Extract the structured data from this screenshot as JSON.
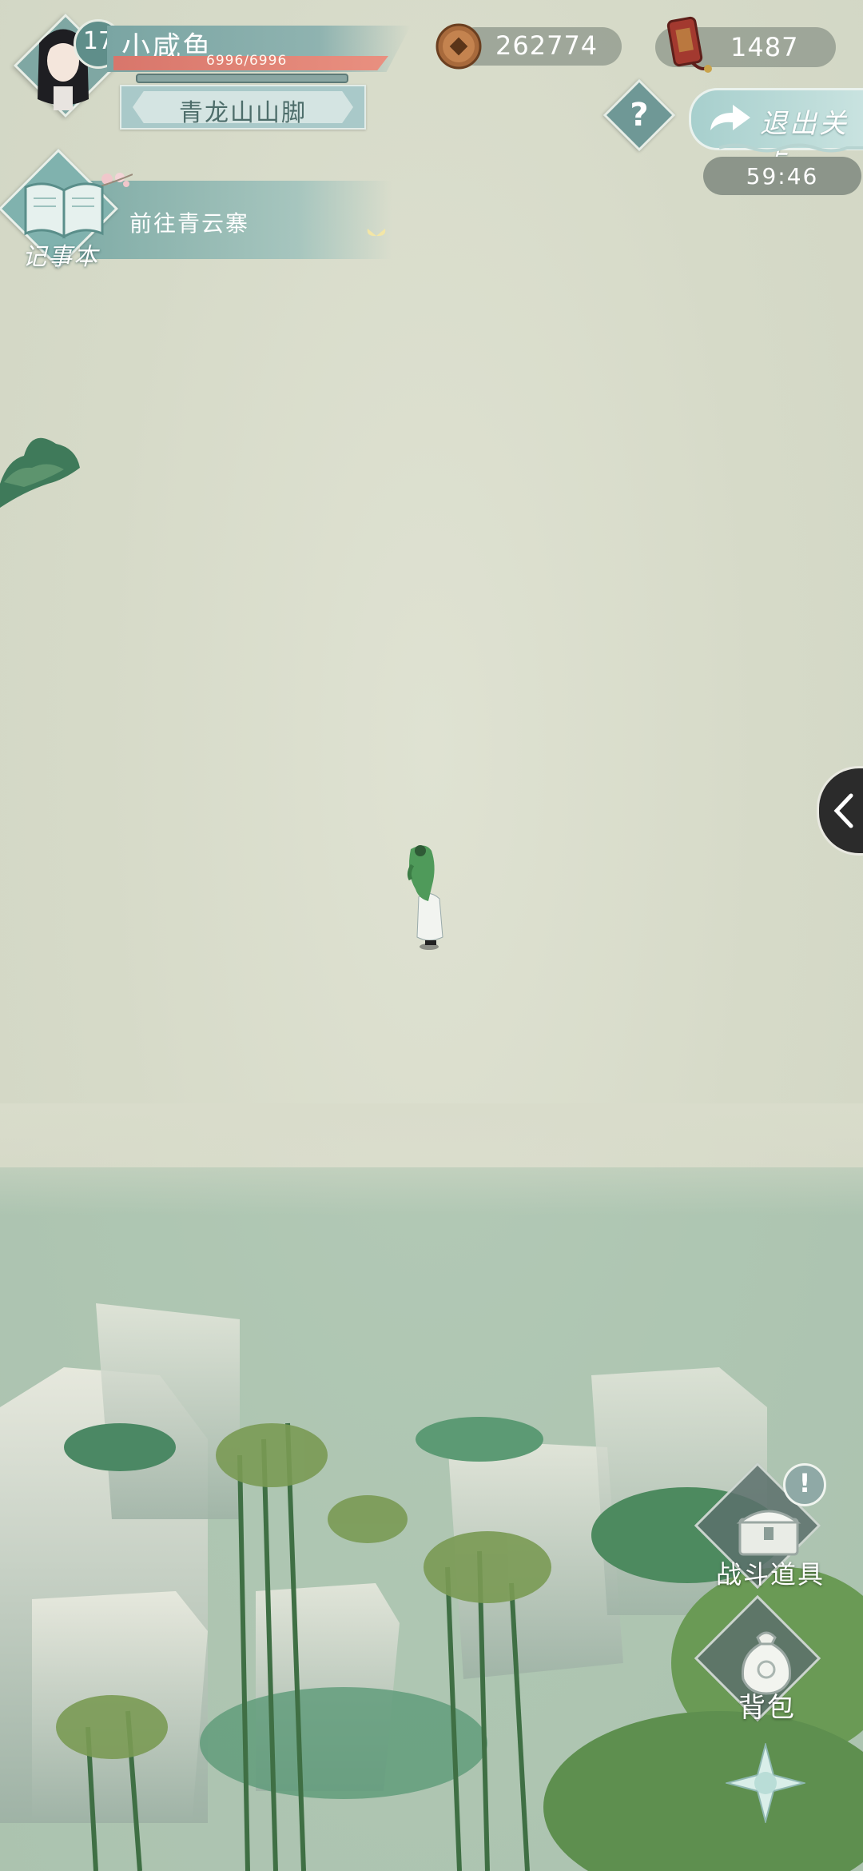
{
  "player": {
    "level": "17",
    "name": "小咸鱼",
    "hp_text": "6996/6996",
    "hp_fraction": 1.0,
    "location": "青龙山山脚"
  },
  "currency": {
    "coins": "262774",
    "tokens": "1487"
  },
  "controls": {
    "help": "?",
    "exit_label": "退出关卡",
    "timer": "59:46"
  },
  "quest": {
    "notebook_label": "记事本",
    "objective": "前往青云寨"
  },
  "side_panel": {
    "icon": "chevron-left-icon"
  },
  "actions": {
    "battle_items_label": "战斗道具",
    "battle_alert": "!",
    "bag_label": "背包"
  },
  "colors": {
    "mist_bg": "#d9dccb",
    "jade_accent": "#7aa5a3",
    "hp_red": "#e08275"
  }
}
